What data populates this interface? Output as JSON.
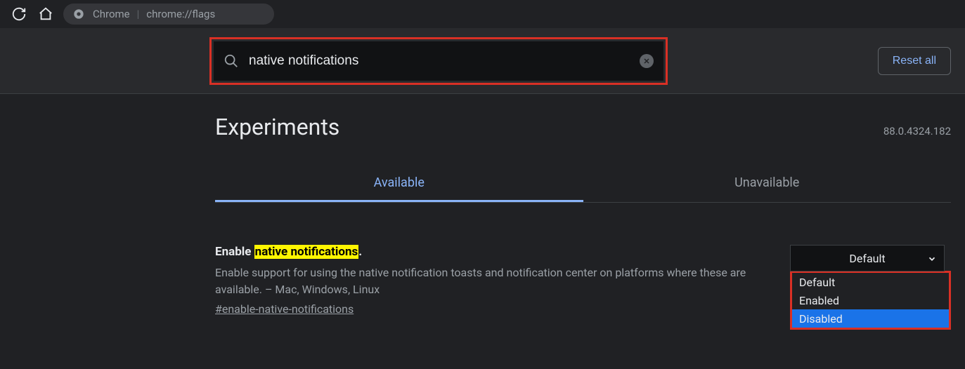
{
  "toolbar": {
    "label": "Chrome",
    "url": "chrome://flags"
  },
  "search": {
    "value": "native notifications"
  },
  "reset_label": "Reset all",
  "page_title": "Experiments",
  "version": "88.0.4324.182",
  "tabs": {
    "available": "Available",
    "unavailable": "Unavailable"
  },
  "flag": {
    "title_prefix": "Enable ",
    "title_highlight": "native notifications",
    "title_suffix": ".",
    "description": "Enable support for using the native notification toasts and notification center on platforms where these are available. – Mac, Windows, Linux",
    "anchor": "#enable-native-notifications",
    "selected": "Default",
    "options": {
      "default": "Default",
      "enabled": "Enabled",
      "disabled": "Disabled"
    }
  }
}
